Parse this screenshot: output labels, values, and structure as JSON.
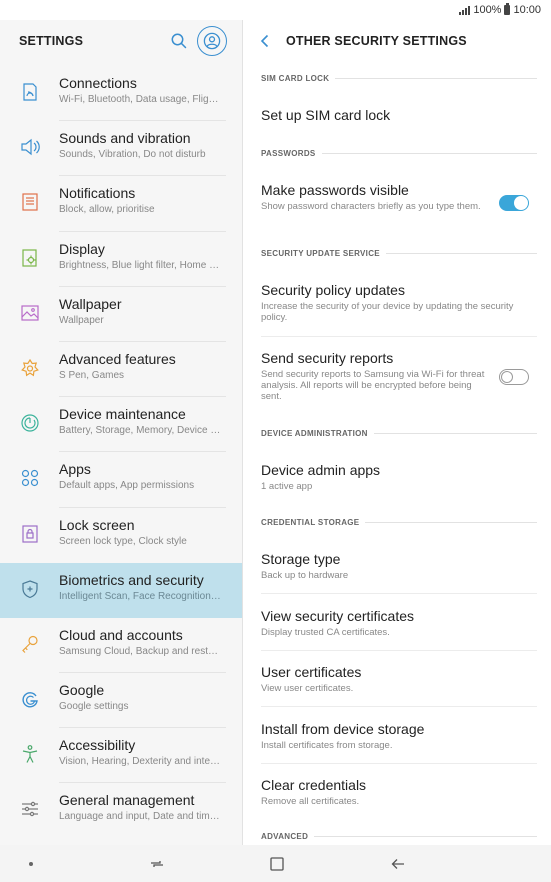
{
  "status_bar": {
    "battery": "100%",
    "time": "10:00"
  },
  "left_panel": {
    "title": "SETTINGS",
    "items": [
      {
        "label": "Connections",
        "sublabel": "Wi-Fi, Bluetooth, Data usage, Flight mode",
        "icon": "connections-icon"
      },
      {
        "label": "Sounds and vibration",
        "sublabel": "Sounds, Vibration, Do not disturb",
        "icon": "sound-icon"
      },
      {
        "label": "Notifications",
        "sublabel": "Block, allow, prioritise",
        "icon": "notifications-icon"
      },
      {
        "label": "Display",
        "sublabel": "Brightness, Blue light filter, Home screen",
        "icon": "display-icon"
      },
      {
        "label": "Wallpaper",
        "sublabel": "Wallpaper",
        "icon": "wallpaper-icon"
      },
      {
        "label": "Advanced features",
        "sublabel": "S Pen, Games",
        "icon": "advanced-features-icon"
      },
      {
        "label": "Device maintenance",
        "sublabel": "Battery, Storage, Memory, Device security",
        "icon": "device-maintenance-icon"
      },
      {
        "label": "Apps",
        "sublabel": "Default apps, App permissions",
        "icon": "apps-icon"
      },
      {
        "label": "Lock screen",
        "sublabel": "Screen lock type, Clock style",
        "icon": "lock-icon"
      },
      {
        "label": "Biometrics and security",
        "sublabel": "Intelligent Scan, Face Recognition, Fingerprints",
        "icon": "shield-icon"
      },
      {
        "label": "Cloud and accounts",
        "sublabel": "Samsung Cloud, Backup and restore",
        "icon": "key-icon"
      },
      {
        "label": "Google",
        "sublabel": "Google settings",
        "icon": "google-icon"
      },
      {
        "label": "Accessibility",
        "sublabel": "Vision, Hearing, Dexterity and interaction",
        "icon": "accessibility-icon"
      },
      {
        "label": "General management",
        "sublabel": "Language and input, Date and time, Reset",
        "icon": "general-management-icon"
      }
    ]
  },
  "right_panel": {
    "title": "OTHER SECURITY SETTINGS",
    "sections": {
      "sim_card_lock": "SIM CARD LOCK",
      "passwords": "PASSWORDS",
      "security_update_service": "SECURITY UPDATE SERVICE",
      "device_administration": "DEVICE ADMINISTRATION",
      "credential_storage": "CREDENTIAL STORAGE",
      "advanced": "ADVANCED"
    },
    "items": {
      "sim_lock": {
        "label": "Set up SIM card lock"
      },
      "passwords_visible": {
        "label": "Make passwords visible",
        "sublabel": "Show password characters briefly as you type them.",
        "toggle": "on"
      },
      "policy_updates": {
        "label": "Security policy updates",
        "sublabel": "Increase the security of your device by updating the security policy."
      },
      "security_reports": {
        "label": "Send security reports",
        "sublabel": "Send security reports to Samsung via Wi-Fi for threat analysis. All reports will be encrypted before being sent.",
        "toggle": "off"
      },
      "device_admin": {
        "label": "Device admin apps",
        "sublabel": "1 active app"
      },
      "storage_type": {
        "label": "Storage type",
        "sublabel": "Back up to hardware"
      },
      "view_certs": {
        "label": "View security certificates",
        "sublabel": "Display trusted CA certificates."
      },
      "user_certs": {
        "label": "User certificates",
        "sublabel": "View user certificates."
      },
      "install_storage": {
        "label": "Install from device storage",
        "sublabel": "Install certificates from storage."
      },
      "clear_credentials": {
        "label": "Clear credentials",
        "sublabel": "Remove all certificates."
      }
    }
  },
  "colors": {
    "accent": "#3aa6d9",
    "active_row": "#bfe0ec"
  }
}
